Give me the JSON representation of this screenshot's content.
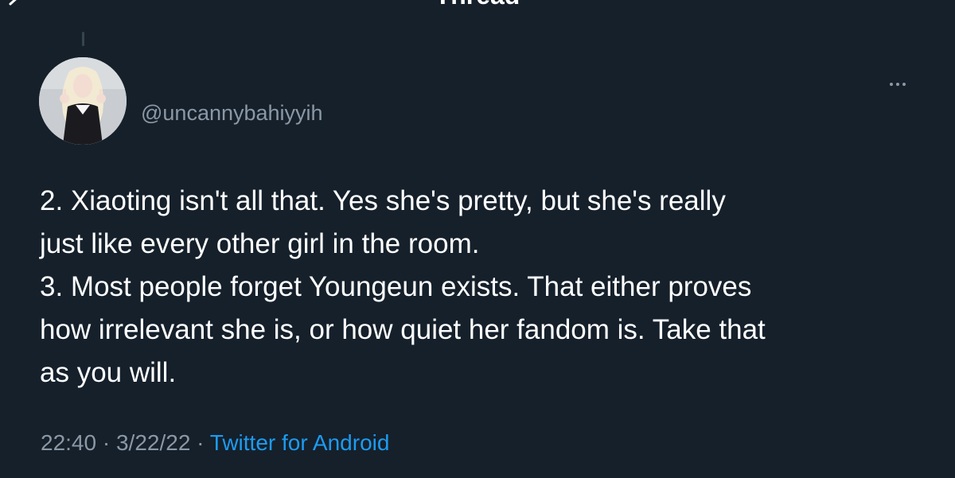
{
  "header": {
    "title": "Thread"
  },
  "tweet": {
    "handle": "@uncannybahiyyih",
    "body_lines": [
      "2. Xiaoting isn't all that. Yes she's pretty, but she's really",
      "just like every other girl in the room.",
      "3. Most people forget Youngeun exists. That either proves",
      "how irrelevant she is, or how quiet her fandom is. Take that",
      "as you will."
    ],
    "time": "22:40",
    "separator": " · ",
    "date": "3/22/22",
    "source": "Twitter for Android"
  },
  "colors": {
    "background": "#15202b",
    "text": "#ffffff",
    "secondary_text": "#8b98a5",
    "link": "#1d9bf0"
  },
  "icons": {
    "back": "arrow-left-icon",
    "more": "more-horizontal-icon"
  }
}
